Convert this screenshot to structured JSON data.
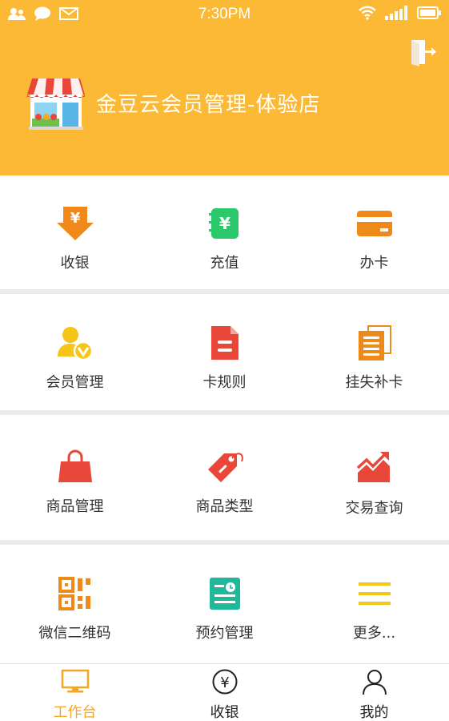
{
  "status_bar": {
    "time": "7:30PM"
  },
  "header": {
    "store_name": "金豆云会员管理-体验店"
  },
  "menu": {
    "row1": {
      "cashier": "收银",
      "recharge": "充值",
      "open_card": "办卡"
    },
    "row2": {
      "member_manage": "会员管理",
      "card_rules": "卡规则",
      "lost_replace": "挂失补卡"
    },
    "row3": {
      "goods_manage": "商品管理",
      "goods_types": "商品类型",
      "transaction_query": "交易查询"
    },
    "row4": {
      "wechat_qr": "微信二维码",
      "booking_manage": "预约管理",
      "more": "更多..."
    }
  },
  "tabbar": {
    "workbench": "工作台",
    "cashier": "收银",
    "mine": "我的"
  },
  "colors": {
    "header": "#fbb935",
    "orange": "#ef8a1a",
    "green": "#2bc96b",
    "red": "#e8473a",
    "yellow": "#f5c518",
    "teal": "#1fb89a",
    "active_tab": "#f5a623"
  }
}
